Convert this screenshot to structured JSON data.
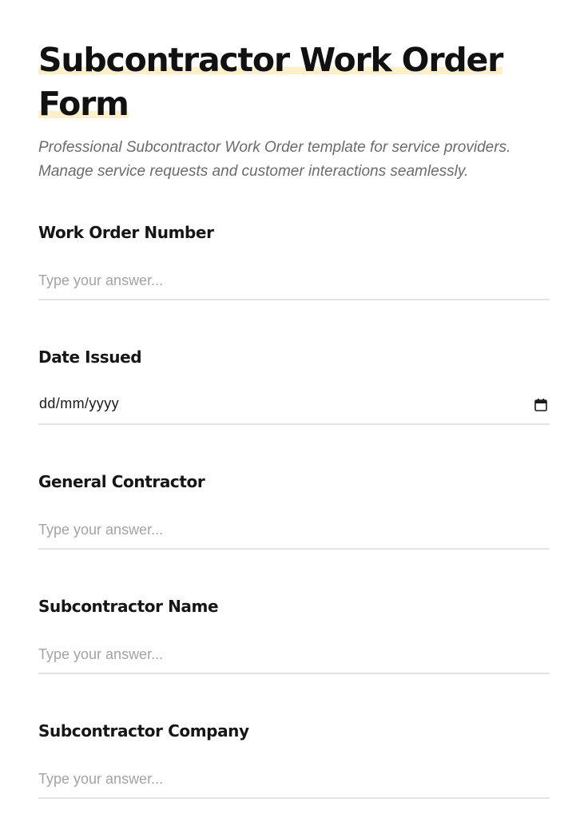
{
  "form": {
    "title": "Subcontractor Work Order Form",
    "description": "Professional Subcontractor Work Order template for service providers. Manage service requests and customer interactions seamlessly."
  },
  "fields": [
    {
      "label": "Work Order Number",
      "type": "text",
      "placeholder": "Type your answer...",
      "value": ""
    },
    {
      "label": "Date Issued",
      "type": "date",
      "display": "dd/mm/yyyy",
      "icon": "calendar-icon"
    },
    {
      "label": "General Contractor",
      "type": "text",
      "placeholder": "Type your answer...",
      "value": ""
    },
    {
      "label": "Subcontractor Name",
      "type": "text",
      "placeholder": "Type your answer...",
      "value": ""
    },
    {
      "label": "Subcontractor Company",
      "type": "text",
      "placeholder": "Type your answer...",
      "value": ""
    }
  ],
  "colors": {
    "title_highlight": "#fdf0c8",
    "input_border": "#e2e2e2",
    "placeholder": "#a3a3a3",
    "description": "#6b6b6b"
  }
}
